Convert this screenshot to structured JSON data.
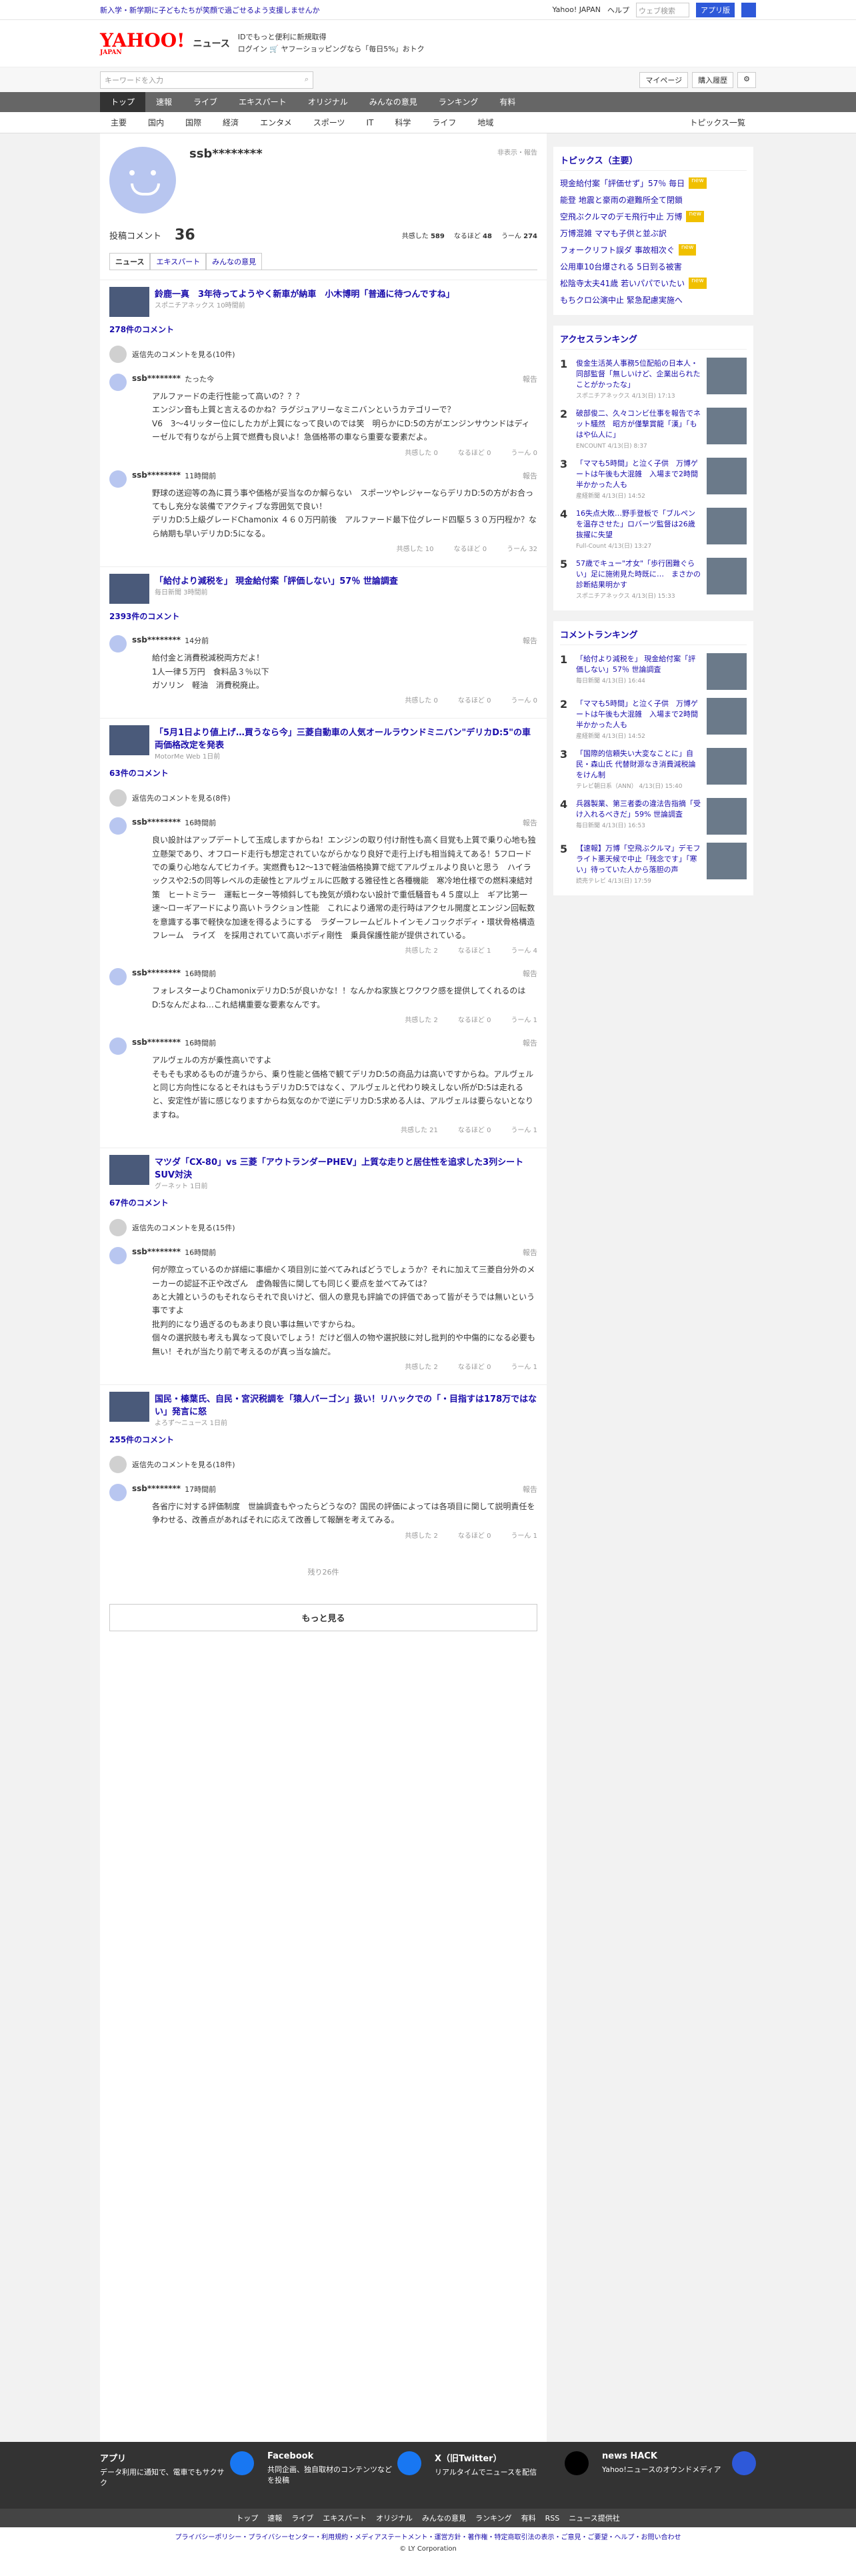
{
  "topbar": {
    "left": "新入学・新学期に子どもたちが笑顔で過ごせるよう支援しませんか",
    "links": [
      "Yahoo! JAPAN",
      "ヘルプ"
    ],
    "search_placeholder": "ウェブ検索",
    "search_btn": "アプリ版"
  },
  "header": {
    "logo": "YAHOO!",
    "logo_sub": "JAPAN",
    "service": "ニュース",
    "msg1": "IDでもっと便利に新規取得",
    "msg2": "ログイン 🛒 ヤフーショッピングなら「毎日5%」おトク"
  },
  "searchrow": {
    "placeholder": "キーワードを入力",
    "right": [
      "マイページ",
      "購入履歴"
    ]
  },
  "nav1": [
    "トップ",
    "速報",
    "ライブ",
    "エキスパート",
    "オリジナル",
    "みんなの意見",
    "ランキング",
    "有料"
  ],
  "nav2": [
    "主要",
    "国内",
    "国際",
    "経済",
    "エンタメ",
    "スポーツ",
    "IT",
    "科学",
    "ライフ",
    "地域"
  ],
  "nav2_last": "トピックス一覧",
  "profile": {
    "name": "ssb********",
    "meta": "非表示・報告",
    "label": "投稿コメント",
    "count": "36",
    "reactions": [
      {
        "label": "共感した",
        "value": "589"
      },
      {
        "label": "なるほど",
        "value": "48"
      },
      {
        "label": "うーん",
        "value": "274"
      }
    ],
    "tabs": [
      "ニュース",
      "エキスパート",
      "みんなの意見"
    ]
  },
  "articles": [
    {
      "title": "鈴鹿一真　3年待ってようやく新車が納車　小木博明「普通に待つんですね」",
      "src": "スポニチアネックス 10時間前",
      "count": "278件のコメント",
      "reply": "返信先のコメントを見る(10件)",
      "comments": [
        {
          "user": "ssb********",
          "time": "たった今",
          "text": "アルファードの走行性能って高いの？？？\nエンジン音も上質と言えるのかね？ラグジュアリーなミニバンというカテゴリーで？\nV6　3〜4リッター位にしたカが上質になって良いのでは笑　明らかにD:5の方がエンジンサウンドはディーゼルで有りながら上質で燃費も良いよ！急価格帯の車なら重要な要素だよ。",
          "r": [
            "0",
            "0",
            "0"
          ]
        },
        {
          "user": "ssb********",
          "time": "11時間前",
          "text": "野球の送迎等の為に買う事や価格が妥当なのか解らない　スポーツやレジャーならデリカD:5の方がお合ってもし充分な装備でアクティブな雰囲気で良い！\nデリカD:5上級グレードChamonix ４６０万円前後　アルファード最下位グレード四駆５３０万円程か？なら納期も早いデリカD:5になる。",
          "r": [
            "10",
            "0",
            "32"
          ]
        }
      ]
    },
    {
      "title": "「給付より減税を」 現金給付案「評価しない」57％ 世論調査",
      "src": "毎日新聞 3時間前",
      "count": "2393件のコメント",
      "reply": "",
      "comments": [
        {
          "user": "ssb********",
          "time": "14分前",
          "text": "給付金と消費税減税両方だよ！\n1人一律５万円　食料品３％以下\nガソリン　軽油　消費税廃止。",
          "r": [
            "0",
            "0",
            "0"
          ]
        }
      ]
    },
    {
      "title": "「5月1日より値上げ…買うなら今」三菱自動車の人気オールラウンドミニバン\"デリカD:5\"の車両価格改定を発表",
      "src": "MotorMe Web 1日前",
      "count": "63件のコメント",
      "reply": "返信先のコメントを見る(8件)",
      "comments": [
        {
          "user": "ssb********",
          "time": "16時間前",
          "text": "良い設計はアップデートして玉成しますからね！エンジンの取り付け耐性も高く目覚も上質で乗り心地も独立懸架であり、オフロード走行も想定されていながらかなり良好で走行上げも相当鈍えてある！5フロードでの乗り心地なんてビカイチ。実燃費も12〜13で軽油価格換算で総てアルヴェルより良いと思う　ハイラックスや2:5の同等レベルの走破性とアルヴェルに匹敵する雅径性と各種機能　寒冷地仕様での燃料凍結対策　ヒートミラー　運転ヒーター等傾斜しても挽気が煩わない設計で重低騒音も４５度以上　ギア比第一速〜ローギアードにより高いトラクション性能　これにより通常の走行時はアクセル開度とエンジン回転数を意識する事で軽快な加速を得るようにする　ラダーフレームビルトインモノコックボディ・環状骨格構造フレーム　ライズ　を採用されていて高いボディ剛性　乗員保護性能が提供されている。",
          "r": [
            "2",
            "1",
            "4"
          ]
        },
        {
          "user": "ssb********",
          "time": "16時間前",
          "text": "フォレスターよりChamonixデリカD:5が良いかな！！なんかね家族とワクワク感を提供してくれるのはD:5なんだよね…これ結構重要な要素なんです。",
          "r": [
            "2",
            "0",
            "1"
          ]
        },
        {
          "user": "ssb********",
          "time": "16時間前",
          "text": "アルヴェルの方が乗性高いですよ\nそもそも求めるものが違うから、乗り性能と価格で観てデリカD:5の商品力は高いですからね。アルヴェルと同じ方向性になるとそれはもうデリカD:5ではなく、アルヴェルと代わり映えしない所がD:5は走れると、安定性が皆に感じなりますからね気なのかで逆にデリカD:5求める人は、アルヴェルは要らないとなりますね。",
          "r": [
            "21",
            "0",
            "1"
          ]
        }
      ]
    },
    {
      "title": "マツダ「CX-80」vs 三菱「アウトランダーPHEV」上質な走りと居住性を追求した3列シートSUV対決",
      "src": "グーネット 1日前",
      "count": "67件のコメント",
      "reply": "返信先のコメントを見る(15件)",
      "comments": [
        {
          "user": "ssb********",
          "time": "16時間前",
          "text": "何が際立っているのか詳細に事細かく項目別に並べてみればどうでしょうか？それに加えて三菱自分外のメーカーの認証不正や改ざん　虚偽報告に関しても同じく要点を並べてみては？\nあと大雑というのもそれならそれで良いけど、個人の意見も評論での評価であって皆がそうでは無いという事ですよ\n批判的になり過ぎるのもあまり良い事は無いですからね。\n個々の選択肢も考えも異なって良いでしょう！だけど個人の物や選択肢に対し批判的や中傷的になる必要も無い！それが当たり前で考えるのが真っ当な論だ。",
          "r": [
            "2",
            "0",
            "1"
          ]
        }
      ]
    },
    {
      "title": "国民・榛葉氏、自民・宮沢税調を「猿人バーゴン」扱い！リハックでの「・目指すは178万ではない」発言に怒",
      "src": "よろず〜ニュース 1日前",
      "count": "255件のコメント",
      "reply": "返信先のコメントを見る(18件)",
      "comments": [
        {
          "user": "ssb********",
          "time": "17時間前",
          "text": "各省庁に対する評価制度　世論調査もやったらどうなの？国民の評価によっては各項目に関して説明責任を争わせる、改善点があればそれに応えて改善して報酬を考えてみる。",
          "r": [
            "2",
            "0",
            "1"
          ]
        }
      ]
    }
  ],
  "footer_more": {
    "remain": "残り26件",
    "btn": "もっと見る"
  },
  "topics": {
    "title": "トピックス（主要）",
    "items": [
      "現金給付案「評価せず」57％ 毎日",
      "能登 地震と豪雨の避難所全て閉鎖",
      "空飛ぶクルマのデモ飛行中止 万博",
      "万博混雑 ママも子供と並ぶ訳",
      "フォークリフト誤ダ 事故相次ぐ",
      "公用車10台爆される 5日到る被害",
      "松陰寺太夫41歳 若いパパでいたい",
      "もちクロ公演中止 緊急配慮実施へ"
    ],
    "badges": [
      "new",
      "",
      "new",
      "",
      "new",
      "",
      "new",
      ""
    ]
  },
  "access": {
    "title": "アクセスランキング",
    "items": [
      {
        "t": "俊金生活英人事務5位配船の日本人・同部監督「無しいけど、企業出られたことがかったな」",
        "s": "スポニチアネックス 4/13(日) 17:13"
      },
      {
        "t": "破部俊二、久々コンビ仕事を報告でネット騒然　昭方が僅撃賞龍「漢」「もはや仏人に」",
        "s": "ENCOUNT 4/13(日) 8:37"
      },
      {
        "t": "「ママも5時間」と泣く子供　万博ゲートは午後も大混雑　入場まで2時間半かかった人も",
        "s": "産経新聞 4/13(日) 14:52"
      },
      {
        "t": "16失点大敗…野手登板で「ブルペンを温存させた」ロバーツ監督は26歳抜擢に失望",
        "s": "Full-Count 4/13(日) 13:27"
      },
      {
        "t": "57歳でキュー\"才女\"「歩行困難ぐらい」足に施術見た時既に…　まさかの診断結果明かす",
        "s": "スポニチアネックス 4/13(日) 15:33"
      }
    ]
  },
  "comment_rank": {
    "title": "コメントランキング",
    "items": [
      {
        "t": "「給付より減税を」 現金給付案「評価しない」57％ 世論調査",
        "s": "毎日新聞 4/13(日) 16:44"
      },
      {
        "t": "「ママも5時間」と泣く子供　万博ゲートは午後も大混雑　入場まで2時間半かかった人も",
        "s": "産経新聞 4/13(日) 14:52"
      },
      {
        "t": "「国際的信頼失い大変なことに」自民・森山氏 代替財源なき消費減税論をけん制",
        "s": "テレビ朝日系（ANN） 4/13(日) 15:40"
      },
      {
        "t": "兵器製業、第三者委の違法告指摘「受け入れるべきだ」59% 世論調査",
        "s": "毎日新聞 4/13(日) 16:53"
      },
      {
        "t": "【速報】万博「空飛ぶクルマ」デモフライト悪天候で中止「残念です」「寒い」待っていた人から落胆の声",
        "s": "読売テレビ 4/13(日) 17:59"
      }
    ]
  },
  "footer": [
    {
      "t": "アプリ",
      "d": "データ利用に通知で、電車でもサクサク"
    },
    {
      "t": "Facebook",
      "d": "共同企画、独自取材のコンテンツなどを投稿"
    },
    {
      "t": "X（旧Twitter）",
      "d": "リアルタイムでニュースを配信"
    },
    {
      "t": "news HACK",
      "d": "Yahoo!ニュースのオウンドメディア"
    }
  ],
  "fnav": [
    "トップ",
    "速報",
    "ライブ",
    "エキスパート",
    "オリジナル",
    "みんなの意見",
    "ランキング",
    "有料",
    "RSS",
    "ニュース提供社"
  ],
  "fbot": "プライバシーポリシー・プライバシーセンター・利用規約・メディアステートメント・運営方針・著作権・特定商取引法の表示・ご意見・ご要望・ヘルプ・お問い合わせ",
  "copy": "© LY Corporation",
  "reaction_labels": [
    "共感した",
    "なるほど",
    "うーん"
  ],
  "report": "報告"
}
